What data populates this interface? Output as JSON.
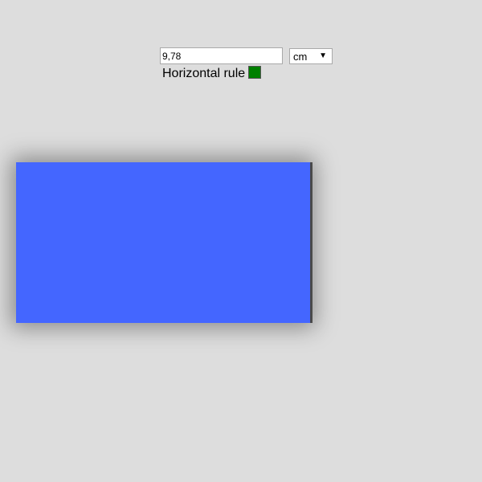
{
  "controls": {
    "value": "9,78",
    "unit": "cm",
    "rule_label": "Horizontal rule",
    "swatch_color": "#008000"
  },
  "box": {
    "fill_color": "#4466ff",
    "edge_color": "#4a4a4a"
  }
}
